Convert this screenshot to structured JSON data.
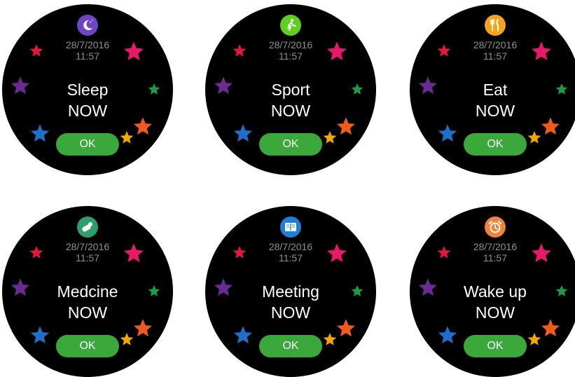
{
  "colors": {
    "background": "#ffffff",
    "watch_face": "#000000",
    "ok_button": "#3aa83a",
    "datetime_text": "#8f8f8f",
    "title_text": "#ffffff"
  },
  "screens": [
    {
      "icon": "sleep-moon-icon",
      "icon_color": "#6f45c8",
      "date": "28/7/2016",
      "time": "11:57",
      "title": "Sleep",
      "subtitle": "NOW",
      "button": "OK"
    },
    {
      "icon": "sport-running-icon",
      "icon_color": "#5fcf1f",
      "date": "28/7/2016",
      "time": "11:57",
      "title": "Sport",
      "subtitle": "NOW",
      "button": "OK"
    },
    {
      "icon": "eat-fork-knife-icon",
      "icon_color": "#f5a31a",
      "date": "28/7/2016",
      "time": "11:57",
      "title": "Eat",
      "subtitle": "NOW",
      "button": "OK"
    },
    {
      "icon": "medicine-pill-icon",
      "icon_color": "#2e9e6a",
      "date": "28/7/2016",
      "time": "11:57",
      "title": "Medcine",
      "subtitle": "NOW",
      "button": "OK"
    },
    {
      "icon": "meeting-book-icon",
      "icon_color": "#1f7ed6",
      "date": "28/7/2016",
      "time": "11:57",
      "title": "Meeting",
      "subtitle": "NOW",
      "button": "OK"
    },
    {
      "icon": "wake-up-alarm-clock-icon",
      "icon_color": "#f2823a",
      "date": "28/7/2016",
      "time": "11:57",
      "title": "Wake up",
      "subtitle": "NOW",
      "button": "OK"
    }
  ],
  "star_colors": [
    "#e2183a",
    "#e8186a",
    "#6a2c91",
    "#1a9c4a",
    "#1d6fc9",
    "#f0a800",
    "#f05a1a"
  ]
}
